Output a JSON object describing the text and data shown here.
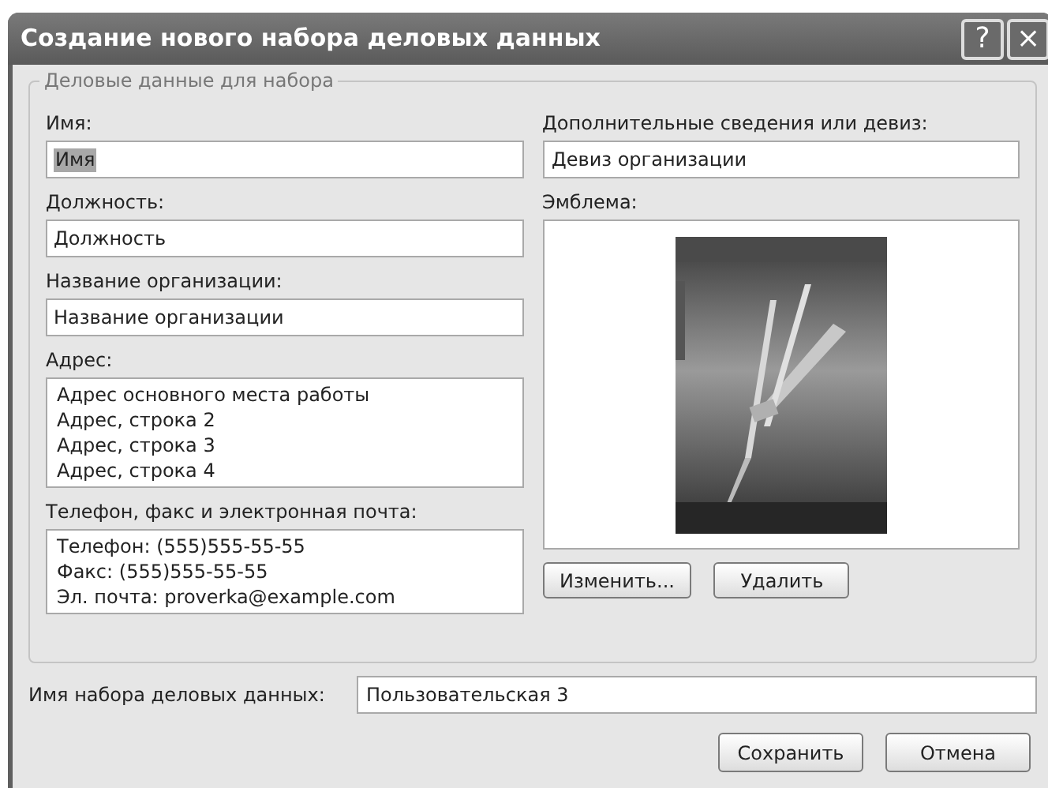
{
  "window": {
    "title": "Создание нового набора деловых данных",
    "buttons": [
      "?",
      "×"
    ]
  },
  "group": {
    "legend": "Деловые данные для набора",
    "left_fields": [
      {
        "kind": "single",
        "label": "Имя:",
        "lines": [
          "Имя"
        ],
        "selected": true
      },
      {
        "kind": "single",
        "label": "Должность:",
        "lines": [
          "Должность"
        ],
        "selected": false
      },
      {
        "kind": "single",
        "label": "Название организации:",
        "lines": [
          "Название организации"
        ],
        "selected": false
      },
      {
        "kind": "multi",
        "label": "Адрес:",
        "lines": [
          "Адрес основного места работы",
          "Адрес, строка 2",
          "Адрес, строка 3",
          "Адрес, строка 4"
        ],
        "selected": false
      },
      {
        "kind": "multi",
        "label": "Телефон, факс и электронная почта:",
        "lines": [
          "Телефон: (555)555-55-55",
          "Факс: (555)555-55-55",
          "Эл. почта: proverka@example.com"
        ],
        "selected": false
      }
    ],
    "motto": {
      "label": "Дополнительные сведения или девиз:",
      "value": "Девиз организации"
    },
    "emblem": {
      "label": "Эмблема:",
      "image": {
        "kind": "picture"
      },
      "buttons": [
        "Изменить...",
        "Удалить"
      ]
    }
  },
  "set_name": {
    "label": "Имя набора деловых данных:",
    "value": "Пользовательская 3"
  },
  "buttons": [
    "Сохранить",
    "Отмена"
  ]
}
